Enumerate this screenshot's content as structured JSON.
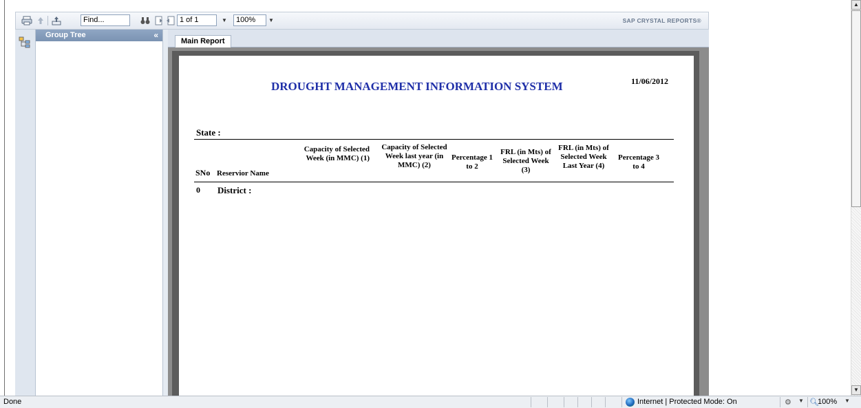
{
  "toolbar": {
    "find_value": "Find...",
    "page_value": "1 of 1",
    "zoom_value": "100%",
    "brand": "SAP CRYSTAL REPORTS®"
  },
  "group_tree": {
    "title": "Group Tree",
    "collapse_glyph": "«"
  },
  "tabs": {
    "main": "Main Report"
  },
  "report": {
    "title": "DROUGHT MANAGEMENT INFORMATION SYSTEM",
    "date": "11/06/2012",
    "state_label": "State :",
    "columns": {
      "sno": "SNo",
      "name": "Reservior Name",
      "cap_selected": "Capacity of Selected Week (in MMC) (1)",
      "cap_last_year": "Capacity of Selected Week last year (in MMC) (2)",
      "pct_1_2": "Percentage 1 to 2",
      "frl_selected": "FRL (in Mts) of Selected Week (3)",
      "frl_last_year": "FRL (in Mts) of Selected Week Last Year (4)",
      "pct_3_4": "Percentage 3 to 4"
    },
    "row": {
      "sno": "0",
      "district_label": "District :"
    },
    "title_color": "#1f2fa8"
  },
  "statusbar": {
    "status": "Done",
    "zone": "Internet | Protected Mode: On",
    "zoom": "100%"
  },
  "icons": [
    "print-icon",
    "export-up-icon",
    "export-icon",
    "search-binoculars-icon",
    "first-page-icon",
    "prev-page-icon",
    "group-tree-toggle-icon",
    "globe-icon",
    "magnifier-icon"
  ]
}
